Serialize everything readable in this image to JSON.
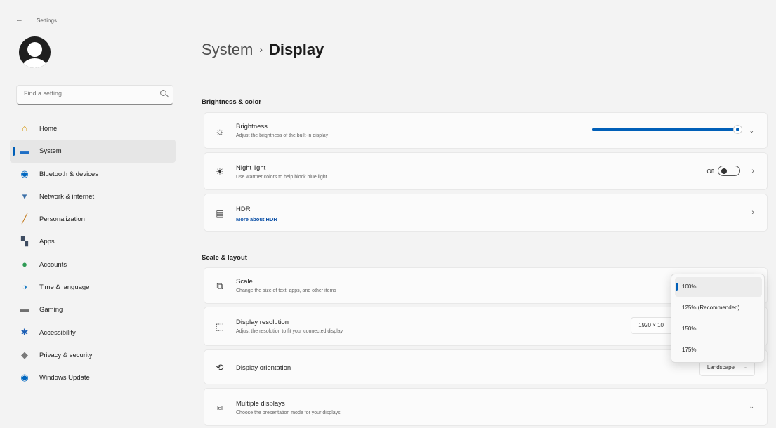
{
  "window": {
    "title": "Settings",
    "back_label": "←"
  },
  "search": {
    "placeholder": "Find a setting"
  },
  "sidebar": {
    "items": [
      {
        "label": "Home",
        "icon": "home-icon",
        "glyph": "⌂",
        "color": "#d29200"
      },
      {
        "label": "System",
        "icon": "system-icon",
        "glyph": "▬",
        "color": "#1f6fc5",
        "active": true
      },
      {
        "label": "Bluetooth & devices",
        "icon": "bluetooth-icon",
        "glyph": "◉",
        "color": "#0067c0"
      },
      {
        "label": "Network & internet",
        "icon": "network-icon",
        "glyph": "▾",
        "color": "#3b6fa7"
      },
      {
        "label": "Personalization",
        "icon": "brush-icon",
        "glyph": "╱",
        "color": "#c27717"
      },
      {
        "label": "Apps",
        "icon": "apps-icon",
        "glyph": "▚",
        "color": "#3f4d62"
      },
      {
        "label": "Accounts",
        "icon": "accounts-icon",
        "glyph": "●",
        "color": "#2e9a54"
      },
      {
        "label": "Time & language",
        "icon": "globe-icon",
        "glyph": "◑",
        "color": "#1679c2"
      },
      {
        "label": "Gaming",
        "icon": "gaming-icon",
        "glyph": "▬",
        "color": "#707070"
      },
      {
        "label": "Accessibility",
        "icon": "accessibility-icon",
        "glyph": "✱",
        "color": "#1d5fb5"
      },
      {
        "label": "Privacy & security",
        "icon": "shield-icon",
        "glyph": "◆",
        "color": "#7a7a7a"
      },
      {
        "label": "Windows Update",
        "icon": "update-icon",
        "glyph": "◉",
        "color": "#0067c0"
      }
    ]
  },
  "breadcrumb": {
    "parent": "System",
    "separator": "›",
    "current": "Display"
  },
  "brightness_color": {
    "heading": "Brightness & color",
    "brightness": {
      "title": "Brightness",
      "desc": "Adjust the brightness of the built-in display",
      "value_fraction": 1.0
    },
    "night_light": {
      "title": "Night light",
      "desc": "Use warmer colors to help block blue light",
      "state": "Off"
    },
    "hdr": {
      "title": "HDR",
      "link": "More about HDR"
    }
  },
  "scale_layout": {
    "heading": "Scale & layout",
    "scale": {
      "title": "Scale",
      "desc": "Change the size of text, apps, and other items"
    },
    "resolution": {
      "title": "Display resolution",
      "desc": "Adjust the resolution to fit your connected display",
      "value": "1920 × 10"
    },
    "orientation": {
      "title": "Display orientation",
      "value": "Landscape"
    },
    "multiple": {
      "title": "Multiple displays",
      "desc": "Choose the presentation mode for your displays"
    }
  },
  "scale_menu": {
    "options": [
      "100%",
      "125% (Recommended)",
      "150%",
      "175%"
    ],
    "selected": "100%"
  },
  "colors": {
    "accent": "#005fb8",
    "link": "#0a4fa6"
  }
}
